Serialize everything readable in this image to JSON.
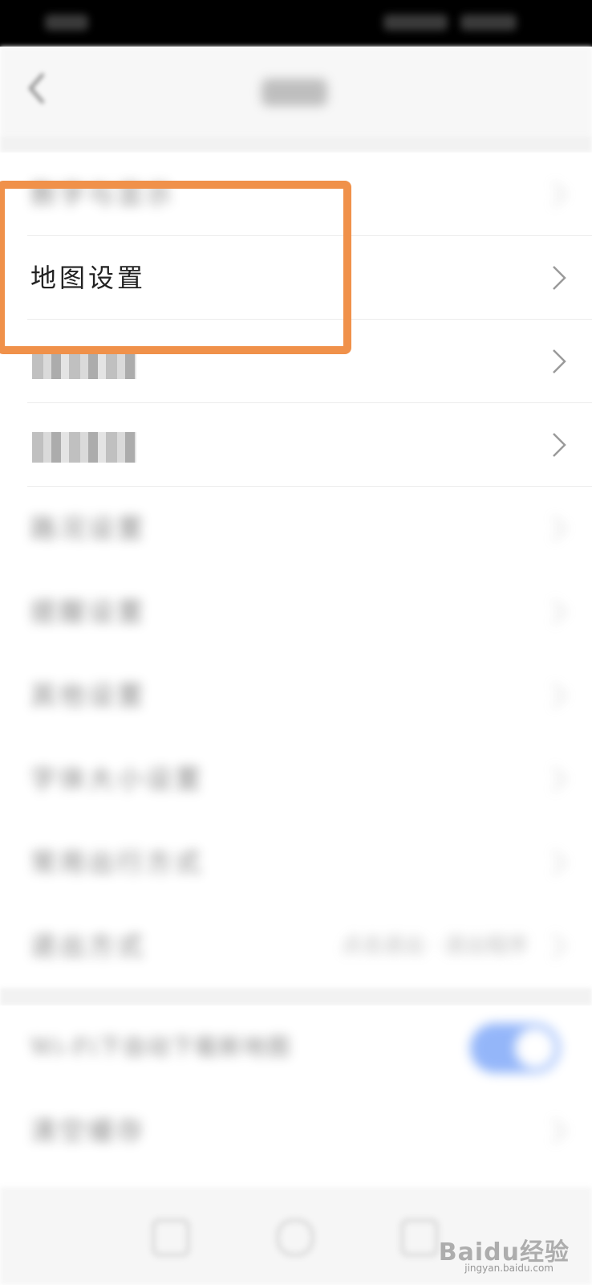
{
  "rows": [
    {
      "label": "数字与显示",
      "blurred": true
    },
    {
      "label": "地图设置",
      "blurred": false
    },
    {
      "label": "",
      "blurred": false
    },
    {
      "label": "",
      "blurred": false
    },
    {
      "label": "路况设置",
      "blurred": true
    },
    {
      "label": "提醒设置",
      "blurred": true
    },
    {
      "label": "其他设置",
      "blurred": true
    },
    {
      "label": "字体大小设置",
      "blurred": true
    },
    {
      "label": "常用出行方式",
      "blurred": true
    },
    {
      "label": "退出方式",
      "blurred": true,
      "value": "点击退出 · 退出程序"
    }
  ],
  "toggle_row": {
    "label": "Wi-Fi下自动下载新地图",
    "state": "on"
  },
  "last_row": {
    "label": "清空缓存"
  },
  "watermark": {
    "main": "Baidu经验",
    "sub": "jingyan.baidu.com"
  },
  "colors": {
    "highlight": "#f0914a",
    "toggle": "#3d7bf5"
  }
}
